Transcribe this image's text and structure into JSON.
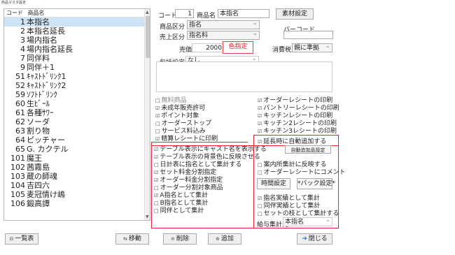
{
  "window": {
    "title": "商品マスタ設定"
  },
  "list": {
    "header_code": "コード",
    "header_name": "商品名",
    "items": [
      {
        "code": "1",
        "name": "本指名"
      },
      {
        "code": "2",
        "name": "本指名延長"
      },
      {
        "code": "3",
        "name": "場内指名"
      },
      {
        "code": "4",
        "name": "場内指名延長"
      },
      {
        "code": "7",
        "name": "同伴料"
      },
      {
        "code": "9",
        "name": "同伴＋1"
      },
      {
        "code": "51",
        "name": "ｷｬｽﾄﾄﾞﾘﾝｸ1"
      },
      {
        "code": "52",
        "name": "ｷｬｽﾄﾄﾞﾘﾝｸ2"
      },
      {
        "code": "59",
        "name": "ｿﾌﾄﾄﾞﾘﾝｸ"
      },
      {
        "code": "60",
        "name": "生ﾋﾞｰﾙ"
      },
      {
        "code": "61",
        "name": "各種ｻﾜｰ"
      },
      {
        "code": "62",
        "name": "ソーダ"
      },
      {
        "code": "63",
        "name": "割り物"
      },
      {
        "code": "64",
        "name": "ピッチャー"
      },
      {
        "code": "65",
        "name": "G. カクテル"
      },
      {
        "code": "101",
        "name": "魔王"
      },
      {
        "code": "102",
        "name": "茜霧島"
      },
      {
        "code": "103",
        "name": "蔵の師魂"
      },
      {
        "code": "104",
        "name": "吉四六"
      },
      {
        "code": "105",
        "name": "麦冠情け嶋"
      },
      {
        "code": "106",
        "name": "鍛高譚"
      }
    ]
  },
  "form": {
    "code_label": "コード",
    "code_value": "1",
    "name_label": "商品名",
    "name_value": "本指名",
    "material_btn": "素材設定",
    "category_label": "商品区分",
    "category_value": "指名",
    "barcode_label": "バーコード",
    "sales_label": "売上区分",
    "sales_value": "指名料",
    "price_label": "売価",
    "price_value": "2000",
    "color_btn": "色指定",
    "tax_label": "消費税",
    "tax_value": "親に準拠",
    "package_label": "包括設定",
    "package_value": "なし"
  },
  "checks_left": [
    {
      "label": "無料商品",
      "mark": "□",
      "gray": true
    },
    {
      "label": "未成年販売許可",
      "mark": "☑"
    },
    {
      "label": "ポイント対象",
      "mark": "☑"
    },
    {
      "label": "オーダーストップ",
      "mark": "□"
    },
    {
      "label": "サービス料込み",
      "mark": "□"
    },
    {
      "label": "精算レシートに印刷",
      "mark": "☑"
    }
  ],
  "checks_right": [
    {
      "label": "オーダーレシートの印刷",
      "mark": "☑"
    },
    {
      "label": "パントリーレシートの印刷",
      "mark": "☑"
    },
    {
      "label": "キッチンレシートの印刷",
      "mark": "☑"
    },
    {
      "label": "キッチン2レシートの印刷",
      "mark": "☑"
    },
    {
      "label": "キッチン3レシートの印刷",
      "mark": "☑"
    }
  ],
  "red_section": {
    "extend_label": "延長時に自動追加する",
    "auto_add_btn": "自動追加品設定",
    "left": [
      {
        "label": "テーブル表示にキャスト名を表示する",
        "mark": "☑"
      },
      {
        "label": "テーブル表示の背景色に反映させる",
        "mark": "☑"
      },
      {
        "label": "日計表に指名として集計する",
        "mark": "□"
      },
      {
        "label": "セット料金分割指定",
        "mark": "☑"
      },
      {
        "label": "オーダー料金分割指定",
        "mark": "☑"
      },
      {
        "label": "オーダー分割対象商品",
        "mark": "□"
      },
      {
        "label": "A指名として集計",
        "mark": "☑"
      },
      {
        "label": "B指名として集計",
        "mark": "□"
      },
      {
        "label": "同伴として集計",
        "mark": "□"
      }
    ],
    "right": [
      {
        "label": "案内所集計に反映する",
        "mark": "□"
      },
      {
        "label": "オーダーレシートにコメント",
        "mark": "□"
      },
      {
        "label": "指名実績として集計",
        "mark": "☑"
      },
      {
        "label": "同伴実績として集計",
        "mark": "□"
      },
      {
        "label": "セットの枝として集計する",
        "mark": "□"
      }
    ],
    "time_btn": "時間設定",
    "back_btn": "*バック設定*",
    "salary_label": "給与集計先",
    "salary_value": "本指名"
  },
  "bottom": {
    "list_btn": "一覧表",
    "move_btn": "移動",
    "delete_btn": "削除",
    "add_btn": "追加",
    "close_btn": "閉じる"
  }
}
